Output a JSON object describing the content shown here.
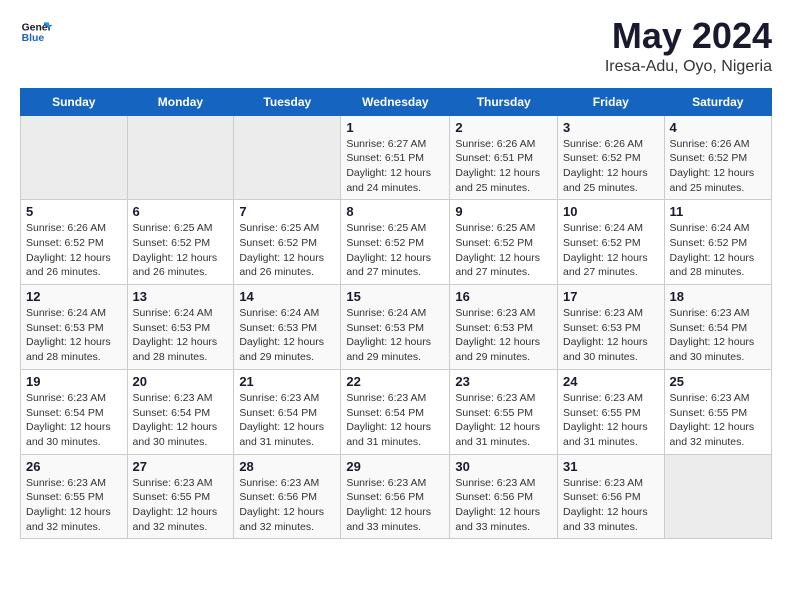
{
  "header": {
    "logo_line1": "General",
    "logo_line2": "Blue",
    "month": "May 2024",
    "location": "Iresa-Adu, Oyo, Nigeria"
  },
  "weekdays": [
    "Sunday",
    "Monday",
    "Tuesday",
    "Wednesday",
    "Thursday",
    "Friday",
    "Saturday"
  ],
  "weeks": [
    [
      {
        "day": "",
        "sunrise": "",
        "sunset": "",
        "daylight": "",
        "empty": true
      },
      {
        "day": "",
        "sunrise": "",
        "sunset": "",
        "daylight": "",
        "empty": true
      },
      {
        "day": "",
        "sunrise": "",
        "sunset": "",
        "daylight": "",
        "empty": true
      },
      {
        "day": "1",
        "sunrise": "Sunrise: 6:27 AM",
        "sunset": "Sunset: 6:51 PM",
        "daylight": "Daylight: 12 hours and 24 minutes.",
        "empty": false
      },
      {
        "day": "2",
        "sunrise": "Sunrise: 6:26 AM",
        "sunset": "Sunset: 6:51 PM",
        "daylight": "Daylight: 12 hours and 25 minutes.",
        "empty": false
      },
      {
        "day": "3",
        "sunrise": "Sunrise: 6:26 AM",
        "sunset": "Sunset: 6:52 PM",
        "daylight": "Daylight: 12 hours and 25 minutes.",
        "empty": false
      },
      {
        "day": "4",
        "sunrise": "Sunrise: 6:26 AM",
        "sunset": "Sunset: 6:52 PM",
        "daylight": "Daylight: 12 hours and 25 minutes.",
        "empty": false
      }
    ],
    [
      {
        "day": "5",
        "sunrise": "Sunrise: 6:26 AM",
        "sunset": "Sunset: 6:52 PM",
        "daylight": "Daylight: 12 hours and 26 minutes.",
        "empty": false
      },
      {
        "day": "6",
        "sunrise": "Sunrise: 6:25 AM",
        "sunset": "Sunset: 6:52 PM",
        "daylight": "Daylight: 12 hours and 26 minutes.",
        "empty": false
      },
      {
        "day": "7",
        "sunrise": "Sunrise: 6:25 AM",
        "sunset": "Sunset: 6:52 PM",
        "daylight": "Daylight: 12 hours and 26 minutes.",
        "empty": false
      },
      {
        "day": "8",
        "sunrise": "Sunrise: 6:25 AM",
        "sunset": "Sunset: 6:52 PM",
        "daylight": "Daylight: 12 hours and 27 minutes.",
        "empty": false
      },
      {
        "day": "9",
        "sunrise": "Sunrise: 6:25 AM",
        "sunset": "Sunset: 6:52 PM",
        "daylight": "Daylight: 12 hours and 27 minutes.",
        "empty": false
      },
      {
        "day": "10",
        "sunrise": "Sunrise: 6:24 AM",
        "sunset": "Sunset: 6:52 PM",
        "daylight": "Daylight: 12 hours and 27 minutes.",
        "empty": false
      },
      {
        "day": "11",
        "sunrise": "Sunrise: 6:24 AM",
        "sunset": "Sunset: 6:52 PM",
        "daylight": "Daylight: 12 hours and 28 minutes.",
        "empty": false
      }
    ],
    [
      {
        "day": "12",
        "sunrise": "Sunrise: 6:24 AM",
        "sunset": "Sunset: 6:53 PM",
        "daylight": "Daylight: 12 hours and 28 minutes.",
        "empty": false
      },
      {
        "day": "13",
        "sunrise": "Sunrise: 6:24 AM",
        "sunset": "Sunset: 6:53 PM",
        "daylight": "Daylight: 12 hours and 28 minutes.",
        "empty": false
      },
      {
        "day": "14",
        "sunrise": "Sunrise: 6:24 AM",
        "sunset": "Sunset: 6:53 PM",
        "daylight": "Daylight: 12 hours and 29 minutes.",
        "empty": false
      },
      {
        "day": "15",
        "sunrise": "Sunrise: 6:24 AM",
        "sunset": "Sunset: 6:53 PM",
        "daylight": "Daylight: 12 hours and 29 minutes.",
        "empty": false
      },
      {
        "day": "16",
        "sunrise": "Sunrise: 6:23 AM",
        "sunset": "Sunset: 6:53 PM",
        "daylight": "Daylight: 12 hours and 29 minutes.",
        "empty": false
      },
      {
        "day": "17",
        "sunrise": "Sunrise: 6:23 AM",
        "sunset": "Sunset: 6:53 PM",
        "daylight": "Daylight: 12 hours and 30 minutes.",
        "empty": false
      },
      {
        "day": "18",
        "sunrise": "Sunrise: 6:23 AM",
        "sunset": "Sunset: 6:54 PM",
        "daylight": "Daylight: 12 hours and 30 minutes.",
        "empty": false
      }
    ],
    [
      {
        "day": "19",
        "sunrise": "Sunrise: 6:23 AM",
        "sunset": "Sunset: 6:54 PM",
        "daylight": "Daylight: 12 hours and 30 minutes.",
        "empty": false
      },
      {
        "day": "20",
        "sunrise": "Sunrise: 6:23 AM",
        "sunset": "Sunset: 6:54 PM",
        "daylight": "Daylight: 12 hours and 30 minutes.",
        "empty": false
      },
      {
        "day": "21",
        "sunrise": "Sunrise: 6:23 AM",
        "sunset": "Sunset: 6:54 PM",
        "daylight": "Daylight: 12 hours and 31 minutes.",
        "empty": false
      },
      {
        "day": "22",
        "sunrise": "Sunrise: 6:23 AM",
        "sunset": "Sunset: 6:54 PM",
        "daylight": "Daylight: 12 hours and 31 minutes.",
        "empty": false
      },
      {
        "day": "23",
        "sunrise": "Sunrise: 6:23 AM",
        "sunset": "Sunset: 6:55 PM",
        "daylight": "Daylight: 12 hours and 31 minutes.",
        "empty": false
      },
      {
        "day": "24",
        "sunrise": "Sunrise: 6:23 AM",
        "sunset": "Sunset: 6:55 PM",
        "daylight": "Daylight: 12 hours and 31 minutes.",
        "empty": false
      },
      {
        "day": "25",
        "sunrise": "Sunrise: 6:23 AM",
        "sunset": "Sunset: 6:55 PM",
        "daylight": "Daylight: 12 hours and 32 minutes.",
        "empty": false
      }
    ],
    [
      {
        "day": "26",
        "sunrise": "Sunrise: 6:23 AM",
        "sunset": "Sunset: 6:55 PM",
        "daylight": "Daylight: 12 hours and 32 minutes.",
        "empty": false
      },
      {
        "day": "27",
        "sunrise": "Sunrise: 6:23 AM",
        "sunset": "Sunset: 6:55 PM",
        "daylight": "Daylight: 12 hours and 32 minutes.",
        "empty": false
      },
      {
        "day": "28",
        "sunrise": "Sunrise: 6:23 AM",
        "sunset": "Sunset: 6:56 PM",
        "daylight": "Daylight: 12 hours and 32 minutes.",
        "empty": false
      },
      {
        "day": "29",
        "sunrise": "Sunrise: 6:23 AM",
        "sunset": "Sunset: 6:56 PM",
        "daylight": "Daylight: 12 hours and 33 minutes.",
        "empty": false
      },
      {
        "day": "30",
        "sunrise": "Sunrise: 6:23 AM",
        "sunset": "Sunset: 6:56 PM",
        "daylight": "Daylight: 12 hours and 33 minutes.",
        "empty": false
      },
      {
        "day": "31",
        "sunrise": "Sunrise: 6:23 AM",
        "sunset": "Sunset: 6:56 PM",
        "daylight": "Daylight: 12 hours and 33 minutes.",
        "empty": false
      },
      {
        "day": "",
        "sunrise": "",
        "sunset": "",
        "daylight": "",
        "empty": true
      }
    ]
  ]
}
